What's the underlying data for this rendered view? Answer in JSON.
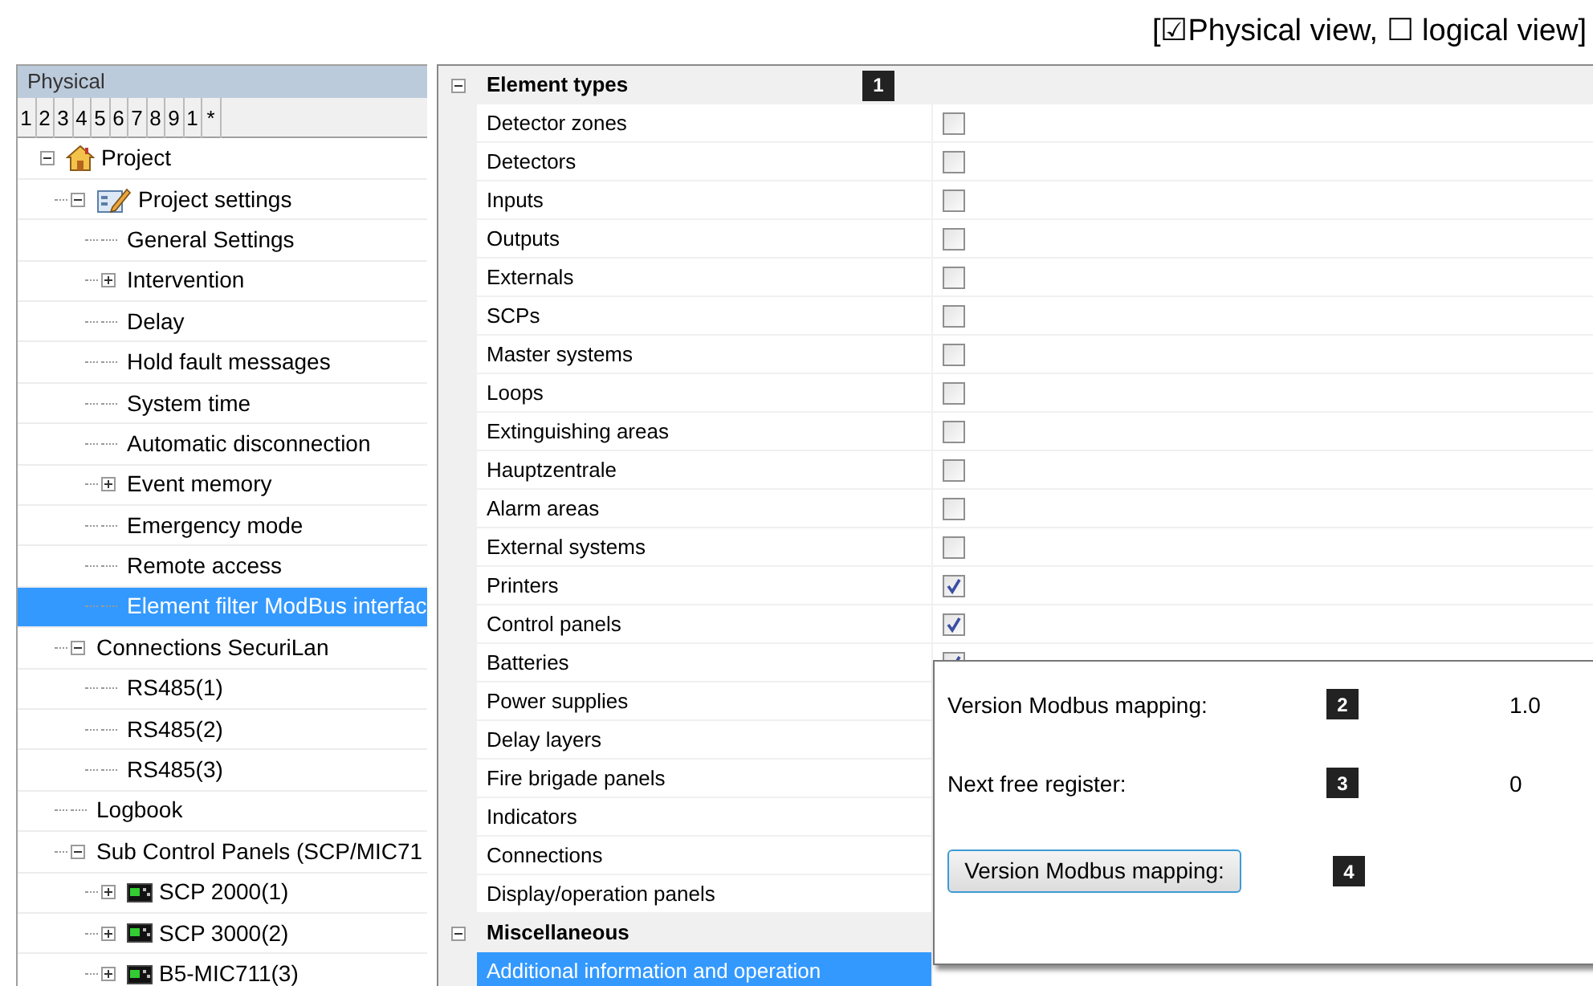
{
  "caption": "[☑Physical view, ☐ logical view]",
  "tree_panel": {
    "title": "Physical",
    "tabs": [
      "1",
      "2",
      "3",
      "4",
      "5",
      "6",
      "7",
      "8",
      "9",
      "1",
      "*"
    ]
  },
  "tree": [
    {
      "label": "Project",
      "kind": "house",
      "expanded": true,
      "selected": false,
      "children": [
        {
          "label": "Project settings",
          "kind": "form",
          "expanded": true,
          "selected": false,
          "children": [
            {
              "label": "General Settings",
              "selected": false
            },
            {
              "label": "Intervention",
              "expanded": false,
              "selected": false
            },
            {
              "label": "Delay",
              "selected": false
            },
            {
              "label": "Hold fault messages",
              "selected": false
            },
            {
              "label": "System time",
              "selected": false
            },
            {
              "label": "Automatic disconnection",
              "selected": false
            },
            {
              "label": "Event memory",
              "expanded": false,
              "selected": false
            },
            {
              "label": "Emergency mode",
              "selected": false
            },
            {
              "label": "Remote access",
              "selected": false
            },
            {
              "label": "Element filter ModBus interfac",
              "selected": true
            }
          ]
        },
        {
          "label": "Connections SecuriLan",
          "expanded": true,
          "selected": false,
          "children": [
            {
              "label": "RS485(1)",
              "selected": false
            },
            {
              "label": "RS485(2)",
              "selected": false
            },
            {
              "label": "RS485(3)",
              "selected": false
            }
          ]
        },
        {
          "label": "Logbook",
          "selected": false
        },
        {
          "label": "Sub Control Panels (SCP/MIC71",
          "expanded": true,
          "selected": false,
          "children": [
            {
              "label": "SCP 2000(1)",
              "kind": "panel",
              "expanded": false,
              "selected": false
            },
            {
              "label": "SCP 3000(2)",
              "kind": "panel",
              "expanded": false,
              "selected": false
            },
            {
              "label": "B5-MIC711(3)",
              "kind": "panel",
              "expanded": false,
              "selected": false
            }
          ]
        }
      ]
    }
  ],
  "property_grid": {
    "categories": [
      {
        "title": "Element types",
        "badge": "1",
        "expanded": true,
        "rows": [
          {
            "label": "Detector zones",
            "checked": false
          },
          {
            "label": "Detectors",
            "checked": false
          },
          {
            "label": "Inputs",
            "checked": false
          },
          {
            "label": "Outputs",
            "checked": false
          },
          {
            "label": "Externals",
            "checked": false
          },
          {
            "label": "SCPs",
            "checked": false
          },
          {
            "label": "Master systems",
            "checked": false
          },
          {
            "label": "Loops",
            "checked": false
          },
          {
            "label": "Extinguishing areas",
            "checked": false
          },
          {
            "label": "Hauptzentrale",
            "checked": false
          },
          {
            "label": "Alarm areas",
            "checked": false
          },
          {
            "label": "External systems",
            "checked": false
          },
          {
            "label": "Printers",
            "checked": true
          },
          {
            "label": "Control panels",
            "checked": true
          },
          {
            "label": "Batteries",
            "checked": true
          },
          {
            "label": "Power supplies"
          },
          {
            "label": "Delay layers"
          },
          {
            "label": "Fire brigade panels"
          },
          {
            "label": "Indicators"
          },
          {
            "label": "Connections"
          },
          {
            "label": "Display/operation panels"
          }
        ]
      },
      {
        "title": "Miscellaneous",
        "expanded": true,
        "rows": [
          {
            "label": "Additional information and operation",
            "selected": true
          }
        ]
      }
    ]
  },
  "popup": {
    "fields": [
      {
        "label": "Version Modbus mapping:",
        "badge": "2",
        "value": "1.0"
      },
      {
        "label": "Next free register:",
        "badge": "3",
        "value": "0"
      }
    ],
    "button": {
      "label": "Version Modbus mapping:",
      "badge": "4"
    }
  }
}
